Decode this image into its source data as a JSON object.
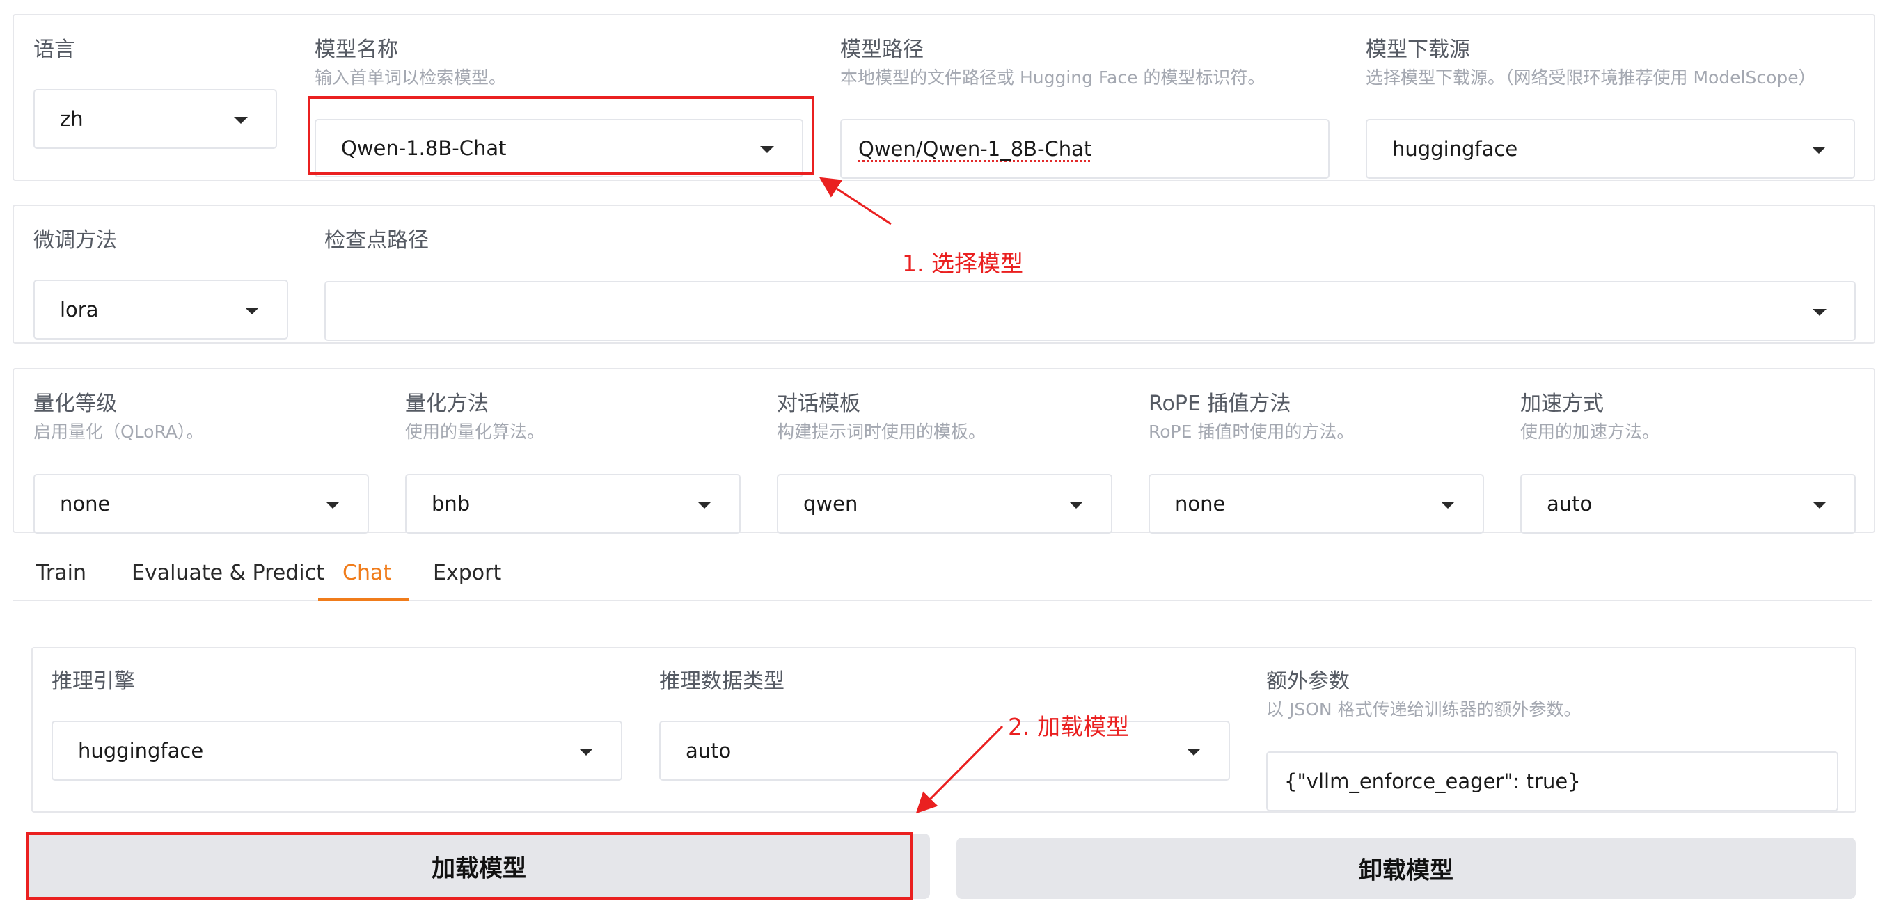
{
  "row1": {
    "language": {
      "label": "语言",
      "value": "zh"
    },
    "model_name": {
      "label": "模型名称",
      "info": "输入首单词以检索模型。",
      "value": "Qwen-1.8B-Chat"
    },
    "model_path": {
      "label": "模型路径",
      "info": "本地模型的文件路径或 Hugging Face 的模型标识符。",
      "value": "Qwen/Qwen-1_8B-Chat"
    },
    "model_source": {
      "label": "模型下载源",
      "info": "选择模型下载源。（网络受限环境推荐使用 ModelScope）",
      "value": "huggingface"
    }
  },
  "row2": {
    "finetune": {
      "label": "微调方法",
      "value": "lora"
    },
    "checkpoint": {
      "label": "检查点路径",
      "value": ""
    }
  },
  "row3": {
    "quant_bit": {
      "label": "量化等级",
      "info": "启用量化（QLoRA）。",
      "value": "none"
    },
    "quant_method": {
      "label": "量化方法",
      "info": "使用的量化算法。",
      "value": "bnb"
    },
    "template": {
      "label": "对话模板",
      "info": "构建提示词时使用的模板。",
      "value": "qwen"
    },
    "rope": {
      "label": "RoPE 插值方法",
      "info": "RoPE 插值时使用的方法。",
      "value": "none"
    },
    "booster": {
      "label": "加速方式",
      "info": "使用的加速方法。",
      "value": "auto"
    }
  },
  "tabs": [
    "Train",
    "Evaluate & Predict",
    "Chat",
    "Export"
  ],
  "active_tab": "Chat",
  "chat": {
    "infer_backend": {
      "label": "推理引擎",
      "value": "huggingface"
    },
    "infer_dtype": {
      "label": "推理数据类型",
      "value": "auto"
    },
    "extra_args": {
      "label": "额外参数",
      "info": "以 JSON 格式传递给训练器的额外参数。",
      "value": "{\"vllm_enforce_eager\": true}"
    },
    "load_button": "加载模型",
    "unload_button": "卸载模型"
  },
  "annotations": {
    "step1": "1. 选择模型",
    "step2": "2. 加载模型",
    "color": "#ea2020"
  },
  "colors": {
    "accent": "#f07c1b",
    "annotation": "#ea2020",
    "button_bg": "#e5e6ea"
  }
}
